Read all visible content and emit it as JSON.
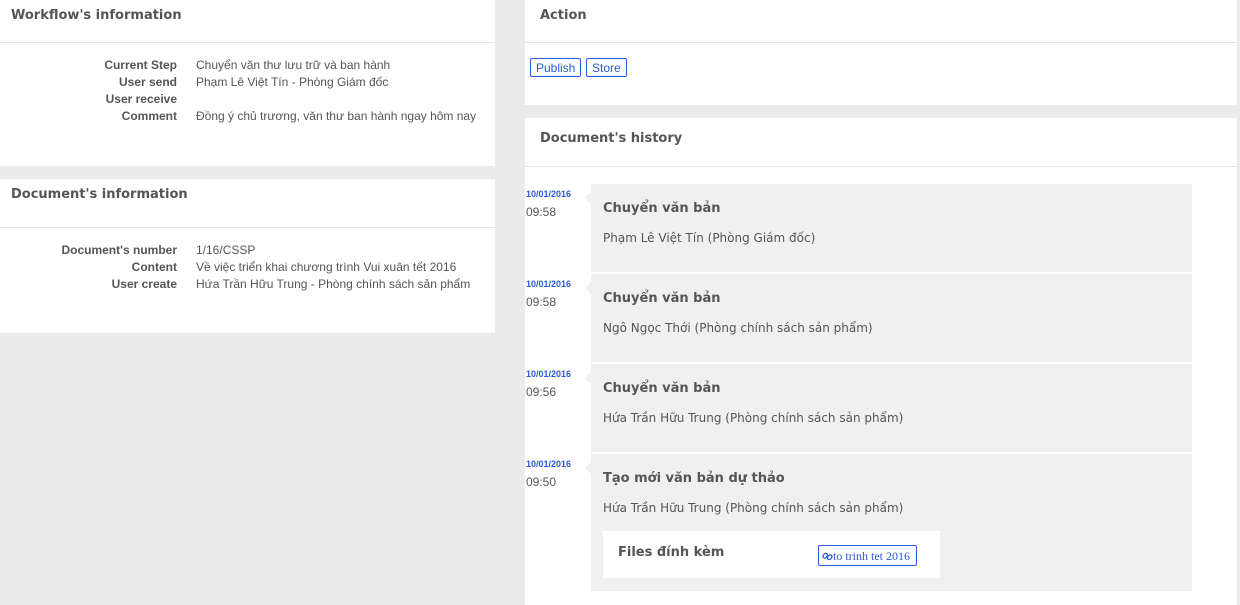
{
  "workflow": {
    "title": "Workflow's information",
    "rows": [
      {
        "label": "Current Step",
        "value": "Chuyển văn thư lưu trữ và ban hành"
      },
      {
        "label": "User send",
        "value": "Phạm Lê Việt Tín - Phòng Giám đốc"
      },
      {
        "label": "User receive",
        "value": ""
      },
      {
        "label": "Comment",
        "value": "Đồng ý chủ trương, văn thư ban hành ngay hôm nay"
      }
    ]
  },
  "document": {
    "title": "Document's information",
    "rows": [
      {
        "label": "Document's number",
        "value": "1/16/CSSP"
      },
      {
        "label": "Content",
        "value": "Về việc triển khai chương trình Vui xuân tết 2016"
      },
      {
        "label": "User create",
        "value": "Hứa Trần Hữu Trung - Phòng chính sách sản phẩm"
      }
    ]
  },
  "action": {
    "title": "Action",
    "publish_label": "Publish",
    "store_label": "Store"
  },
  "history": {
    "title": "Document's history",
    "items": [
      {
        "date": "10/01/2016",
        "time": "09:58",
        "title": "Chuyển văn bản",
        "user": "Phạm Lê Việt Tín (Phòng Giám đốc)"
      },
      {
        "date": "10/01/2016",
        "time": "09:58",
        "title": "Chuyển văn bản",
        "user": "Ngô Ngọc Thới (Phòng chính sách sản phẩm)"
      },
      {
        "date": "10/01/2016",
        "time": "09:56",
        "title": "Chuyển văn bản",
        "user": "Hứa Trần Hữu Trung (Phòng chính sách sản phẩm)"
      },
      {
        "date": "10/01/2016",
        "time": "09:50",
        "title": "Tạo mới văn bản dự thảo",
        "user": "Hứa Trần Hữu Trung (Phòng chính sách sản phẩm)",
        "files_title": "Files đính kèm",
        "file_name": "to trinh tet 2016",
        "file_icon": "link-icon"
      }
    ]
  },
  "colors": {
    "accent": "#2a5bd7",
    "page_bg": "#ebebeb",
    "card_bg": "#f0f0f0"
  }
}
